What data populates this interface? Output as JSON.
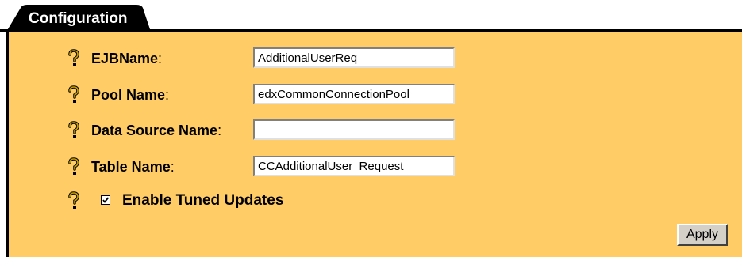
{
  "tab": {
    "label": "Configuration"
  },
  "fields": [
    {
      "label": "EJBName",
      "colon": ":",
      "value": "AdditionalUserReq"
    },
    {
      "label": "Pool Name",
      "colon": ":",
      "value": "edxCommonConnectionPool"
    },
    {
      "label": "Data Source Name",
      "colon": ":",
      "value": ""
    },
    {
      "label": "Table Name",
      "colon": ":",
      "value": "CCAdditionalUser_Request"
    }
  ],
  "tuned_updates": {
    "label": "Enable Tuned Updates",
    "checked": true
  },
  "apply_label": "Apply",
  "colors": {
    "panel": "#ffcc66",
    "tab": "#000000",
    "help_icon": "#b8860b"
  },
  "icons": {
    "help": "question-mark-icon",
    "checkbox": "checkmark-icon"
  }
}
